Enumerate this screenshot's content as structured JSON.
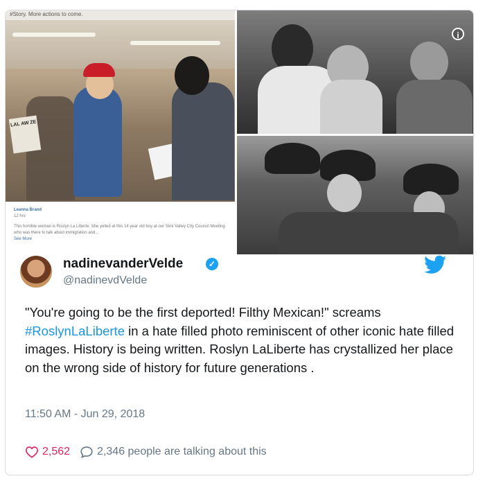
{
  "media": {
    "top_strip_text": "#Story. More actions to come.",
    "sign_text": "LAL AW ZE",
    "caption_author": "Leanna Brand",
    "caption_time": "12 hrs",
    "caption_body": "This horrible woman is Roslyn La Liberte. She yelled at this 14 year old boy at our Simi Valley City Council Meeting who was there to talk about immigration and...",
    "caption_more": "See More"
  },
  "tweet": {
    "display_name": "nadinevanderVelde",
    "handle": "@nadinevdVelde",
    "text_before": "\"You're going to be the first deported! Filthy Mexican!\" screams ",
    "hashtag": "#RoslynLaLiberte",
    "text_after": " in a hate filled photo reminiscent of other iconic hate filled images. History is being written. Roslyn LaLiberte has crystallized her place on the wrong side of history for future generations .",
    "timestamp": "11:50 AM - Jun 29, 2018",
    "likes": "2,562",
    "talking": "2,346 people are talking about this"
  },
  "colors": {
    "accent": "#1da1f2",
    "like": "#e0245e",
    "muted": "#657786",
    "hashtag": "#1b95e0"
  },
  "icons": [
    "info-icon",
    "verified-icon",
    "twitter-bird-icon",
    "heart-icon",
    "speech-bubble-icon"
  ]
}
